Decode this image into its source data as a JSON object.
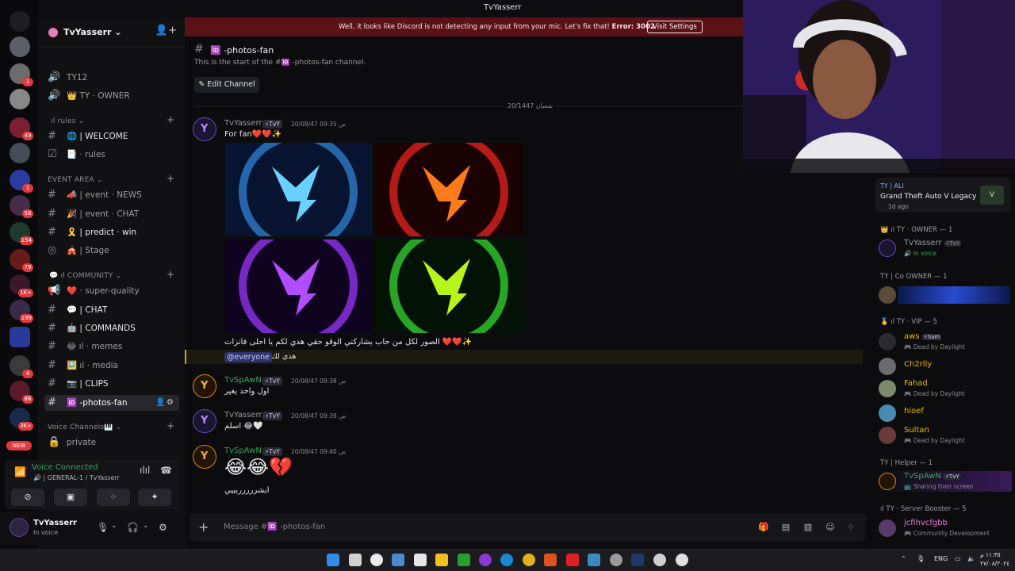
{
  "window": {
    "title": "TvYasserr"
  },
  "banner": {
    "message": "Well, it looks like Discord is not detecting any input from your mic. Let's fix that!",
    "error": "Error: 3002",
    "button": "Visit Settings"
  },
  "rail": {
    "badges": [
      "1",
      "49",
      "1",
      "56",
      "154",
      "79",
      "1K+",
      "199",
      "4",
      "86",
      "3K+"
    ],
    "new_label": "NEW"
  },
  "server": {
    "name": "TvYasserr"
  },
  "channels": [
    {
      "icon": "volume-icon",
      "label": "TY12"
    },
    {
      "icon": "volume-icon",
      "label": "👑 TY · OWNER"
    },
    {
      "category": "ıl rules"
    },
    {
      "icon": "hash",
      "label": "🌐 | WELCOME"
    },
    {
      "icon": "rules-icon",
      "label": "📑 · rules"
    },
    {
      "category": "EVENT AREA"
    },
    {
      "icon": "hash",
      "label": "📣 | event · NEWS"
    },
    {
      "icon": "hash",
      "label": "🎉 | event · CHAT"
    },
    {
      "icon": "hash",
      "label": "🎗️ | predict · win"
    },
    {
      "icon": "stage-icon",
      "label": "🎪 | Stage"
    },
    {
      "category": "💬 ıl COMMUNITY"
    },
    {
      "icon": "megaphone-icon",
      "label": "❤️ · super-quality"
    },
    {
      "icon": "hash",
      "label": "💬 | CHAT"
    },
    {
      "icon": "hash",
      "label": "🤖 | COMMANDS"
    },
    {
      "icon": "hash",
      "label": "😂 ıl · memes"
    },
    {
      "icon": "hash",
      "label": "🖼️ ıl · media"
    },
    {
      "icon": "hash",
      "label": "📷 | CLIPS"
    },
    {
      "icon": "hash",
      "label": "🆔 -photos-fan",
      "selected": true
    },
    {
      "category": "Voice Channels🎹"
    },
    {
      "icon": "lock-icon",
      "label": "private"
    }
  ],
  "voice": {
    "status": "Voice Connected",
    "channel": "| GENERAL-1 / TvYasserr"
  },
  "user": {
    "name": "TvYasserr",
    "status": "In voice"
  },
  "header": {
    "channel": "🆔 -photos-fan"
  },
  "chat": {
    "start_text": "This is the start of the #🆔 -photos-fan channel.",
    "edit_channel": "Edit Channel",
    "date_divider": "شعبان 20/1447",
    "messages": [
      {
        "author": "TvYasserr",
        "tag": "⚡TvY",
        "time": "20/08/47 09:35 ص",
        "text": "For fan❤️❤️✨",
        "color": "#9b9ca3"
      },
      {
        "author": "",
        "tag": "",
        "time": "",
        "text": "الصور لكل من حاب يشاركني الوقو حقي هذي لكم يا احلى فانزات ❤️❤️✨",
        "color": "#e6e6e6"
      },
      {
        "author": "",
        "tag": "",
        "time": "",
        "text": "هذي لك",
        "color": "#e6e6e6"
      },
      {
        "author": "TvSpAwN",
        "tag": "⚡TvY",
        "time": "20/08/47 09:38 ص",
        "text": "اول واحد يغير",
        "color": "#3ba55c"
      },
      {
        "author": "TvYasserr",
        "tag": "⚡TvY",
        "time": "20/08/47 09:39 ص",
        "text": "اسلم 😂🤍",
        "color": "#9b9ca3"
      },
      {
        "author": "TvSpAwN",
        "tag": "⚡TvY",
        "time": "20/08/47 09:40 ص",
        "text": "😂😂💔",
        "color": "#3ba55c"
      },
      {
        "author": "",
        "tag": "",
        "time": "",
        "text": "ابشرررررببيي",
        "color": "#e6e6e6"
      }
    ],
    "mention": "@everyone",
    "composer_placeholder": "Message #🆔 -photos-fan"
  },
  "activity": {
    "user": "TY | ALI",
    "game": "Grand Theft Auto V Legacy",
    "time": "1d ago"
  },
  "members": {
    "groups": [
      {
        "title": "👑 ıl TY · OWNER — 1",
        "items": [
          {
            "name": "TvYasserr",
            "tag": "⚡TvY",
            "status": "🔊 In voice",
            "color": "#9b9ca3"
          }
        ]
      },
      {
        "title": "TY | Co OWNER — 1",
        "items": [
          {
            "name": "",
            "status": "",
            "color": "#9b9ca3"
          }
        ]
      },
      {
        "title": "🥇 ıl TY · VIP — 5",
        "items": [
          {
            "name": "aws",
            "tag": "⚡Sam",
            "status": "🎮 Dead by Daylight",
            "color": "#e6b800"
          },
          {
            "name": "Ch2rlly",
            "status": "",
            "color": "#e6b800"
          },
          {
            "name": "Fahad",
            "status": "🎮 Dead by Daylight",
            "color": "#e6b800"
          },
          {
            "name": "hioef",
            "status": "",
            "color": "#e6b800"
          },
          {
            "name": "Sultan",
            "status": "🎮 Dead by Daylight",
            "color": "#e6b800"
          }
        ]
      },
      {
        "title": "TY | Helper — 1",
        "items": [
          {
            "name": "TvSpAwN",
            "tag": "⚡TvY",
            "status": "📺 Sharing their screen",
            "color": "#3ba55c"
          }
        ]
      },
      {
        "title": "ıl TY · Server Booster — 5",
        "items": [
          {
            "name": "jcfihvcfgbb",
            "status": "🎮 Community Development",
            "color": "#e87ad6"
          }
        ]
      }
    ]
  },
  "taskbar": {
    "lang": "ENG",
    "clock_line1": "١١:٣٥ م",
    "clock_line2": "٢٧/٠٨/٢٠٢٤"
  },
  "colors": {
    "accent": "#5865f2",
    "green": "#3ba55c",
    "red": "#e03a3e"
  }
}
